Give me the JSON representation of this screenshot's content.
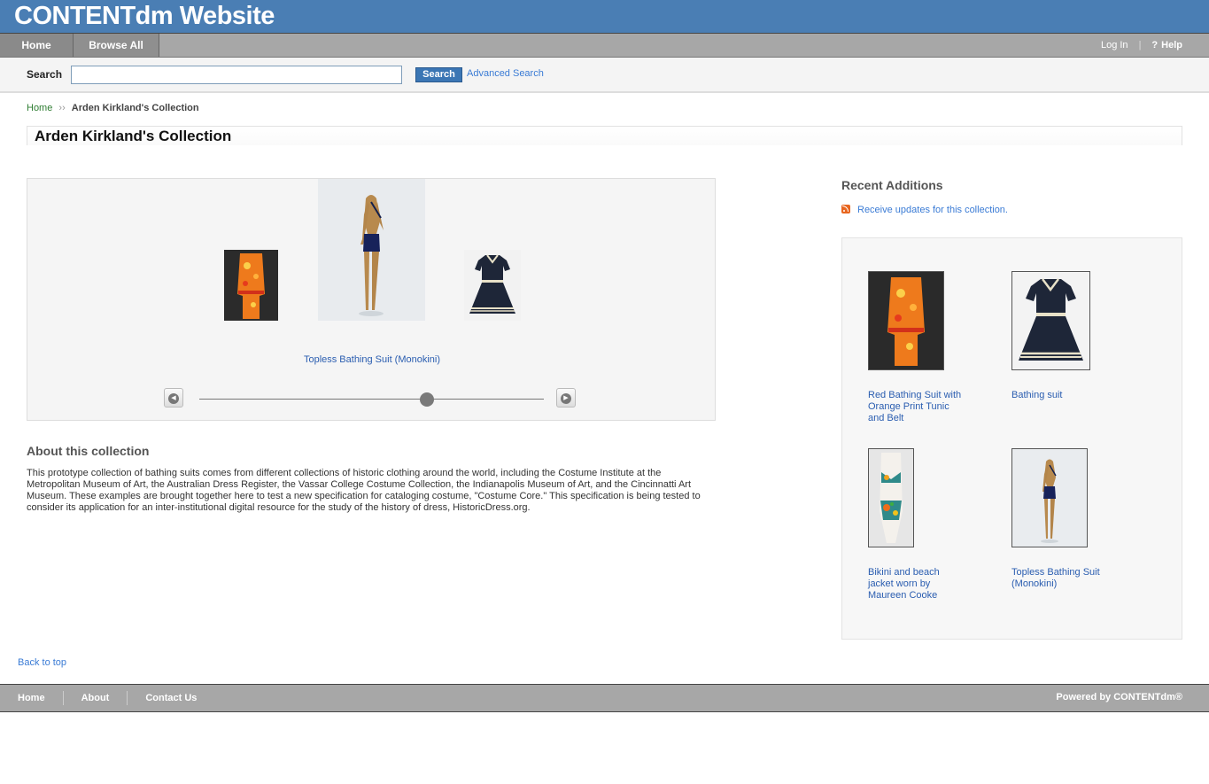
{
  "banner": {
    "title": "CONTENTdm Website"
  },
  "nav": {
    "tabs": [
      {
        "label": "Home"
      },
      {
        "label": "Browse All"
      }
    ],
    "login": "Log In",
    "help_icon": "?",
    "help": "Help"
  },
  "search": {
    "label": "Search",
    "value": "",
    "placeholder": "",
    "button": "Search",
    "advanced": "Advanced Search"
  },
  "breadcrumb": {
    "home": "Home",
    "separator": "››",
    "current": "Arden Kirkland's Collection"
  },
  "page_title": "Arden Kirkland's Collection",
  "carousel": {
    "caption": "Topless Bathing Suit (Monokini)",
    "prev_icon": "◀",
    "next_icon": "▶",
    "slider_position": 0.66
  },
  "about": {
    "title": "About this collection",
    "text": "This prototype collection of bathing suits comes from different collections of historic clothing around the world, including the Costume Institute at the Metropolitan Museum of Art, the Australian Dress Register, the Vassar College Costume Collection, the Indianapolis Museum of Art, and the Cincinnatti Art Museum. These examples are brought together here to test a new specification for cataloging costume, \"Costume Core.\" This specification is being tested to consider its application for an inter-institutional digital resource for the study of the history of dress, HistoricDress.org."
  },
  "recent": {
    "title": "Recent Additions",
    "rss_link": "Receive updates for this collection.",
    "items": [
      {
        "caption": "Red Bathing Suit with Orange Print Tunic and Belt"
      },
      {
        "caption": "Bathing suit"
      },
      {
        "caption": "Bikini and beach jacket worn by Maureen Cooke"
      },
      {
        "caption": "Topless Bathing Suit (Monokini)"
      }
    ]
  },
  "back_to_top": "Back to top",
  "footer": {
    "links": [
      {
        "label": "Home"
      },
      {
        "label": "About"
      },
      {
        "label": "Contact Us"
      }
    ],
    "powered": "Powered by CONTENTdm®"
  }
}
